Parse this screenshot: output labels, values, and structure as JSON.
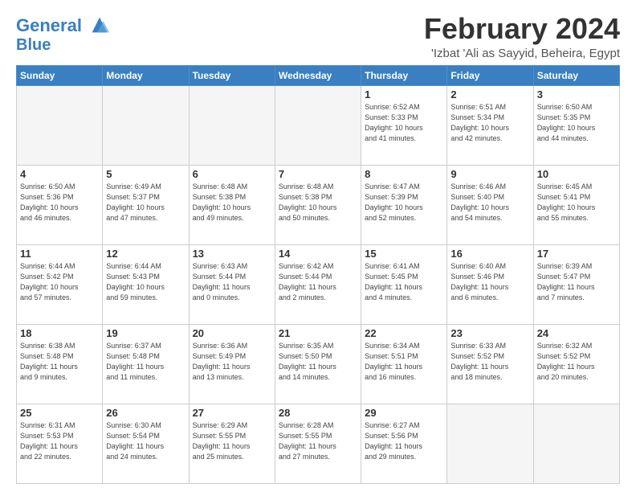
{
  "header": {
    "logo_line1": "General",
    "logo_line2": "Blue",
    "month": "February 2024",
    "location": "'Izbat 'Ali as Sayyid, Beheira, Egypt"
  },
  "weekdays": [
    "Sunday",
    "Monday",
    "Tuesday",
    "Wednesday",
    "Thursday",
    "Friday",
    "Saturday"
  ],
  "weeks": [
    [
      {
        "day": "",
        "info": ""
      },
      {
        "day": "",
        "info": ""
      },
      {
        "day": "",
        "info": ""
      },
      {
        "day": "",
        "info": ""
      },
      {
        "day": "1",
        "info": "Sunrise: 6:52 AM\nSunset: 5:33 PM\nDaylight: 10 hours\nand 41 minutes."
      },
      {
        "day": "2",
        "info": "Sunrise: 6:51 AM\nSunset: 5:34 PM\nDaylight: 10 hours\nand 42 minutes."
      },
      {
        "day": "3",
        "info": "Sunrise: 6:50 AM\nSunset: 5:35 PM\nDaylight: 10 hours\nand 44 minutes."
      }
    ],
    [
      {
        "day": "4",
        "info": "Sunrise: 6:50 AM\nSunset: 5:36 PM\nDaylight: 10 hours\nand 46 minutes."
      },
      {
        "day": "5",
        "info": "Sunrise: 6:49 AM\nSunset: 5:37 PM\nDaylight: 10 hours\nand 47 minutes."
      },
      {
        "day": "6",
        "info": "Sunrise: 6:48 AM\nSunset: 5:38 PM\nDaylight: 10 hours\nand 49 minutes."
      },
      {
        "day": "7",
        "info": "Sunrise: 6:48 AM\nSunset: 5:38 PM\nDaylight: 10 hours\nand 50 minutes."
      },
      {
        "day": "8",
        "info": "Sunrise: 6:47 AM\nSunset: 5:39 PM\nDaylight: 10 hours\nand 52 minutes."
      },
      {
        "day": "9",
        "info": "Sunrise: 6:46 AM\nSunset: 5:40 PM\nDaylight: 10 hours\nand 54 minutes."
      },
      {
        "day": "10",
        "info": "Sunrise: 6:45 AM\nSunset: 5:41 PM\nDaylight: 10 hours\nand 55 minutes."
      }
    ],
    [
      {
        "day": "11",
        "info": "Sunrise: 6:44 AM\nSunset: 5:42 PM\nDaylight: 10 hours\nand 57 minutes."
      },
      {
        "day": "12",
        "info": "Sunrise: 6:44 AM\nSunset: 5:43 PM\nDaylight: 10 hours\nand 59 minutes."
      },
      {
        "day": "13",
        "info": "Sunrise: 6:43 AM\nSunset: 5:44 PM\nDaylight: 11 hours\nand 0 minutes."
      },
      {
        "day": "14",
        "info": "Sunrise: 6:42 AM\nSunset: 5:44 PM\nDaylight: 11 hours\nand 2 minutes."
      },
      {
        "day": "15",
        "info": "Sunrise: 6:41 AM\nSunset: 5:45 PM\nDaylight: 11 hours\nand 4 minutes."
      },
      {
        "day": "16",
        "info": "Sunrise: 6:40 AM\nSunset: 5:46 PM\nDaylight: 11 hours\nand 6 minutes."
      },
      {
        "day": "17",
        "info": "Sunrise: 6:39 AM\nSunset: 5:47 PM\nDaylight: 11 hours\nand 7 minutes."
      }
    ],
    [
      {
        "day": "18",
        "info": "Sunrise: 6:38 AM\nSunset: 5:48 PM\nDaylight: 11 hours\nand 9 minutes."
      },
      {
        "day": "19",
        "info": "Sunrise: 6:37 AM\nSunset: 5:48 PM\nDaylight: 11 hours\nand 11 minutes."
      },
      {
        "day": "20",
        "info": "Sunrise: 6:36 AM\nSunset: 5:49 PM\nDaylight: 11 hours\nand 13 minutes."
      },
      {
        "day": "21",
        "info": "Sunrise: 6:35 AM\nSunset: 5:50 PM\nDaylight: 11 hours\nand 14 minutes."
      },
      {
        "day": "22",
        "info": "Sunrise: 6:34 AM\nSunset: 5:51 PM\nDaylight: 11 hours\nand 16 minutes."
      },
      {
        "day": "23",
        "info": "Sunrise: 6:33 AM\nSunset: 5:52 PM\nDaylight: 11 hours\nand 18 minutes."
      },
      {
        "day": "24",
        "info": "Sunrise: 6:32 AM\nSunset: 5:52 PM\nDaylight: 11 hours\nand 20 minutes."
      }
    ],
    [
      {
        "day": "25",
        "info": "Sunrise: 6:31 AM\nSunset: 5:53 PM\nDaylight: 11 hours\nand 22 minutes."
      },
      {
        "day": "26",
        "info": "Sunrise: 6:30 AM\nSunset: 5:54 PM\nDaylight: 11 hours\nand 24 minutes."
      },
      {
        "day": "27",
        "info": "Sunrise: 6:29 AM\nSunset: 5:55 PM\nDaylight: 11 hours\nand 25 minutes."
      },
      {
        "day": "28",
        "info": "Sunrise: 6:28 AM\nSunset: 5:55 PM\nDaylight: 11 hours\nand 27 minutes."
      },
      {
        "day": "29",
        "info": "Sunrise: 6:27 AM\nSunset: 5:56 PM\nDaylight: 11 hours\nand 29 minutes."
      },
      {
        "day": "",
        "info": ""
      },
      {
        "day": "",
        "info": ""
      }
    ]
  ]
}
